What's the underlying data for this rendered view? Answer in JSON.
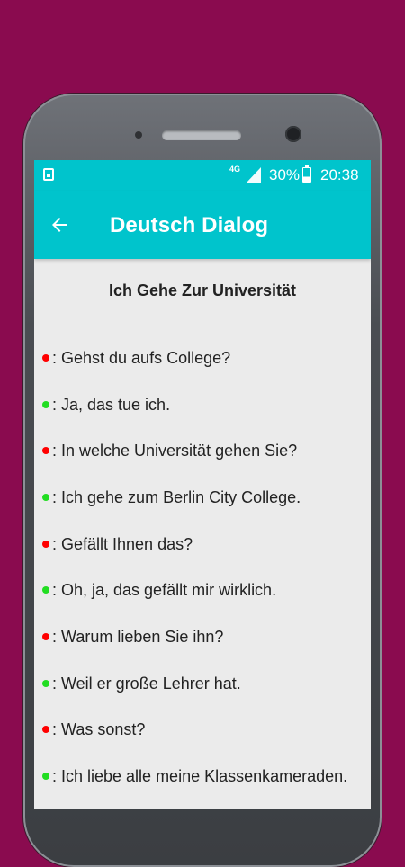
{
  "status_bar": {
    "network": "4G",
    "battery": "30%",
    "time": "20:38"
  },
  "app_bar": {
    "title": "Deutsch Dialog"
  },
  "dialog": {
    "title": "Ich Gehe Zur Universität",
    "speaker_colors": {
      "a": "#ff0000",
      "b": "#22dd22"
    },
    "lines": [
      {
        "speaker": "a",
        "text": ": Gehst du aufs College?"
      },
      {
        "speaker": "b",
        "text": ": Ja, das tue ich."
      },
      {
        "speaker": "a",
        "text": ": In welche Universität gehen Sie?"
      },
      {
        "speaker": "b",
        "text": ": Ich gehe zum Berlin City College."
      },
      {
        "speaker": "a",
        "text": ": Gefällt Ihnen das?"
      },
      {
        "speaker": "b",
        "text": ": Oh, ja, das gefällt mir wirklich."
      },
      {
        "speaker": "a",
        "text": ": Warum lieben Sie ihn?"
      },
      {
        "speaker": "b",
        "text": ": Weil er große Lehrer hat."
      },
      {
        "speaker": "a",
        "text": ": Was sonst?"
      },
      {
        "speaker": "b",
        "text": ": Ich liebe alle meine Klassenkameraden."
      }
    ]
  }
}
